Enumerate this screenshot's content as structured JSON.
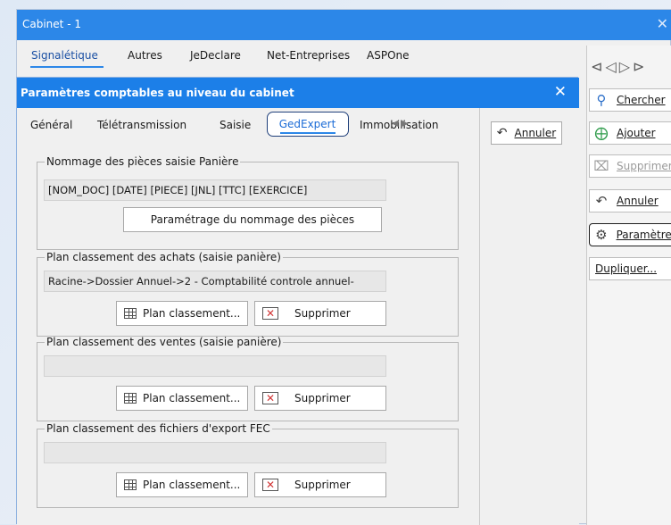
{
  "back_window": {
    "title": "Cabinet - 1",
    "close_glyph": "✕",
    "tabs": [
      "Signalétique",
      "Autres",
      "JeDeclare",
      "Net-Entreprises",
      "ASPOne"
    ],
    "nav_arrows": "⊲◁▷⊳",
    "side_buttons": {
      "chercher": "Chercher",
      "ajouter": "Ajouter",
      "supprimer": "Supprimer",
      "annuler": "Annuler",
      "parametres": "Paramètres",
      "dupliquer": "Dupliquer..."
    }
  },
  "dialog": {
    "title": "Paramètres comptables au niveau du cabinet",
    "close_glyph": "✕",
    "tabs": [
      "Général",
      "Télétransmission",
      "Saisie",
      "GedExpert",
      "Immobilisation"
    ],
    "tab_scroll_arrows": "◀ ▶",
    "annuler_label": "Annuler",
    "groups": {
      "nommage": {
        "legend": "Nommage des pièces saisie Panière",
        "value": "[NOM_DOC]  [DATE] [PIECE] [JNL] [TTC] [EXERCICE]",
        "button": "Paramétrage du nommage des pièces"
      },
      "achats": {
        "legend": "Plan classement des achats (saisie panière)",
        "value": "Racine->Dossier Annuel->2 - Comptabilité controle annuel-",
        "plan_button": "Plan classement...",
        "supprimer_button": "Supprimer"
      },
      "ventes": {
        "legend": "Plan classement des ventes (saisie panière)",
        "value": "",
        "plan_button": "Plan classement...",
        "supprimer_button": "Supprimer"
      },
      "fec": {
        "legend": "Plan classement des fichiers d'export FEC",
        "value": "",
        "plan_button": "Plan classement...",
        "supprimer_button": "Supprimer"
      }
    }
  },
  "colors": {
    "titlebar": "#1c7fe8",
    "accent": "#2c87e8",
    "delete_icon": "#d23636"
  }
}
